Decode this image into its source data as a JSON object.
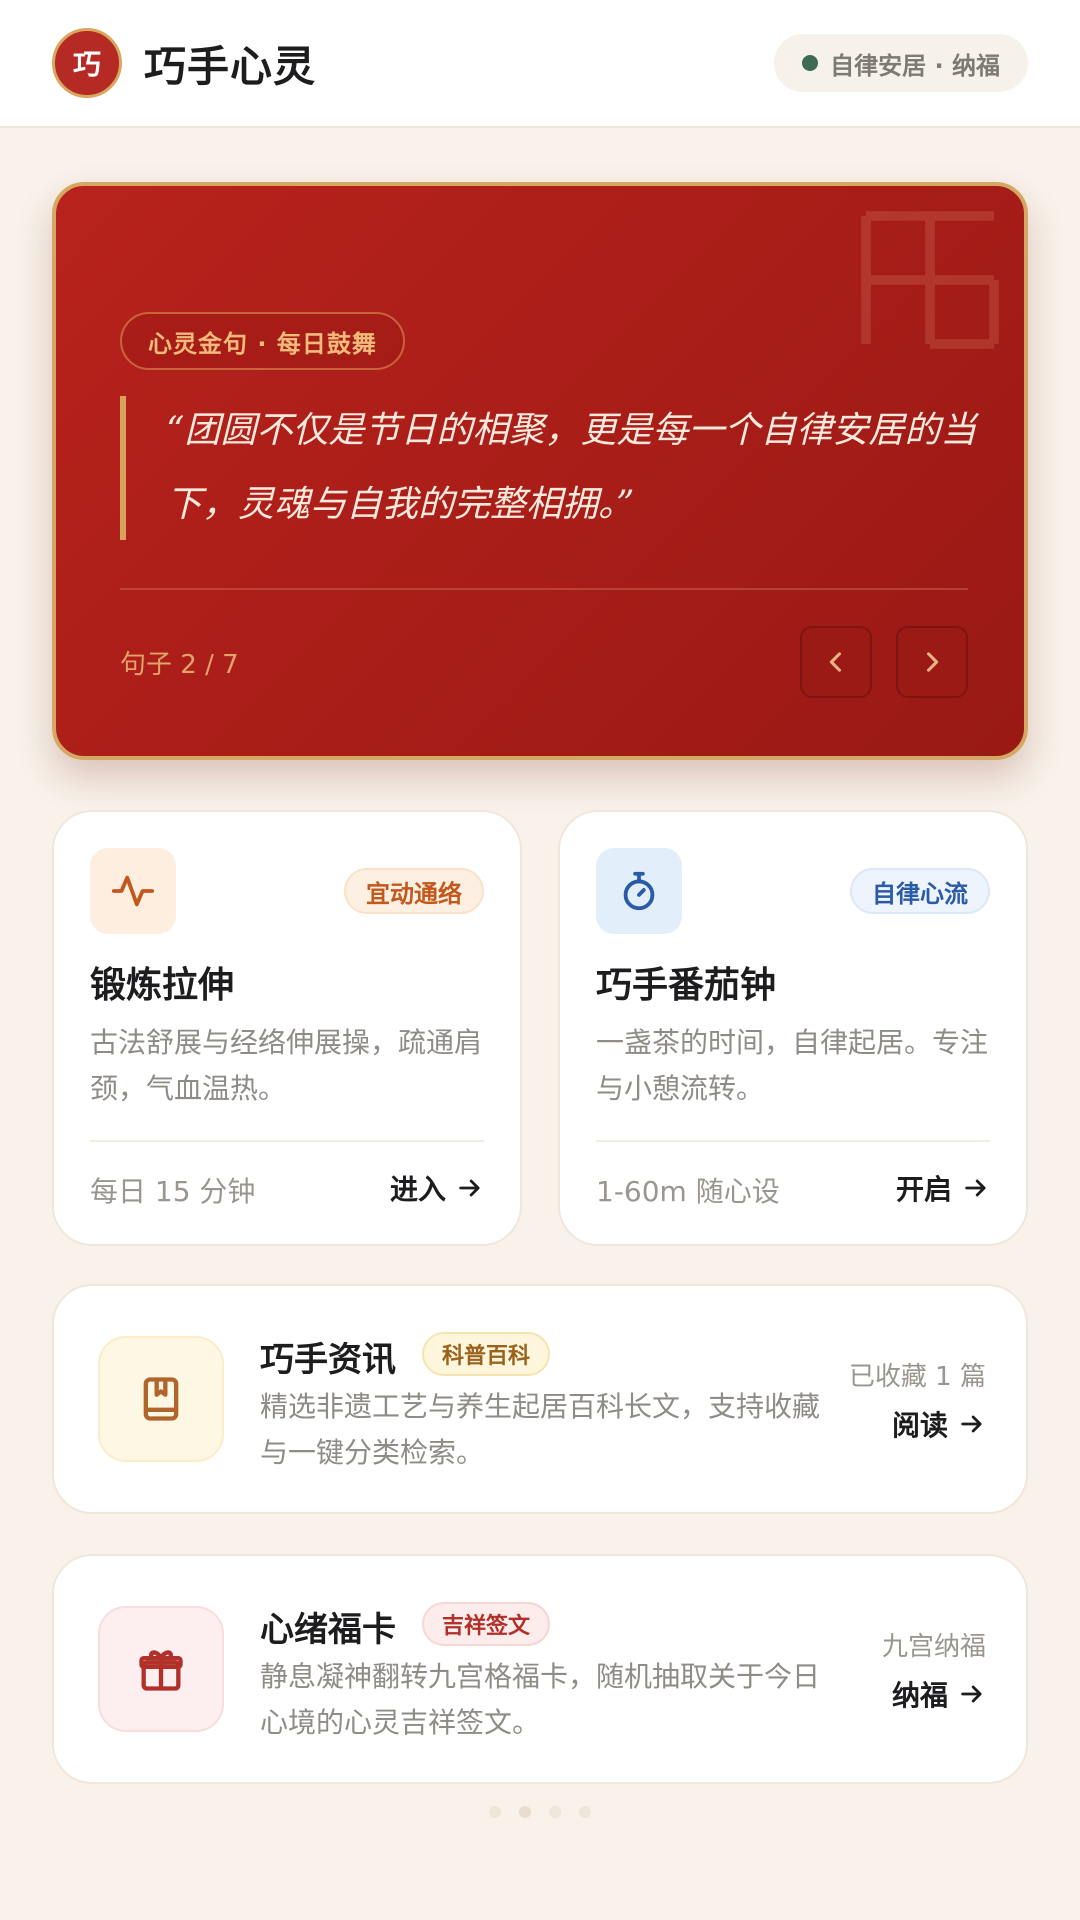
{
  "header": {
    "logo_char": "巧",
    "title": "巧手心灵",
    "status": "自律安居 · 纳福"
  },
  "quote_card": {
    "tag": "心灵金句 · 每日鼓舞",
    "text": "“团圆不仅是节日的相聚，更是每一个自律安居的当下，灵魂与自我的完整相拥。”",
    "counter": "句子 2 / 7"
  },
  "cards": {
    "exercise": {
      "icon": "pulse-icon",
      "tag": "宜动通络",
      "title": "锻炼拉伸",
      "desc": "古法舒展与经络伸展操，疏通肩颈，气血温热。",
      "meta": "每日 15 分钟",
      "action": "进入"
    },
    "pomodoro": {
      "icon": "stopwatch-icon",
      "tag": "自律心流",
      "title": "巧手番茄钟",
      "desc": "一盏茶的时间，自律起居。专注与小憩流转。",
      "meta": "1-60m 随心设",
      "action": "开启"
    },
    "news": {
      "icon": "book-icon",
      "title": "巧手资讯",
      "tag": "科普百科",
      "desc": "精选非遗工艺与养生起居百科长文，支持收藏与一键分类检索。",
      "meta": "已收藏 1 篇",
      "action": "阅读"
    },
    "fortune": {
      "icon": "gift-icon",
      "title": "心绪福卡",
      "tag": "吉祥签文",
      "desc": "静息凝神翻转九宫格福卡，随机抽取关于今日心境的心灵吉祥签文。",
      "meta": "九宫纳福",
      "action": "纳福"
    }
  },
  "colors": {
    "brand_red": "#b52a24",
    "gold": "#d4a862",
    "background": "#f8f2ea"
  }
}
